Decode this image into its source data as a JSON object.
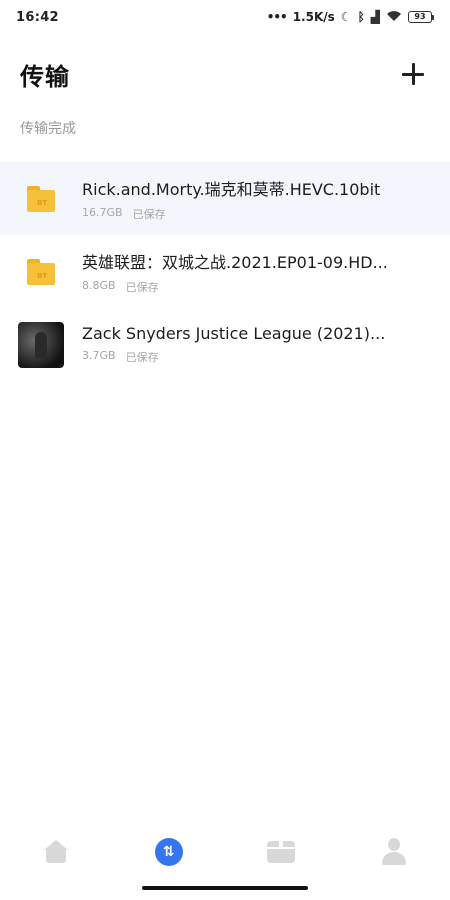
{
  "status_bar": {
    "time": "16:42",
    "network_speed": "1.5K/s",
    "battery_level": "93",
    "icons": [
      "moon-icon",
      "bluetooth-icon",
      "signal-icon",
      "wifi-icon",
      "battery-icon"
    ]
  },
  "header": {
    "title": "传输",
    "add_icon": "plus-icon"
  },
  "section": {
    "label": "传输完成"
  },
  "transfers": [
    {
      "name": "Rick.and.Morty.瑞克和莫蒂.HEVC.10bit",
      "size": "16.7GB",
      "status": "已保存",
      "icon": "folder-icon",
      "selected": true
    },
    {
      "name": "英雄联盟：双城之战.2021.EP01-09.HD...",
      "size": "8.8GB",
      "status": "已保存",
      "icon": "folder-icon",
      "selected": false
    },
    {
      "name": "Zack Snyders Justice League (2021)...",
      "size": "3.7GB",
      "status": "已保存",
      "icon": "video-thumbnail",
      "selected": false
    }
  ],
  "bottom_nav": {
    "items": [
      "home-icon",
      "transfer-icon",
      "box-icon",
      "user-icon"
    ],
    "active": "transfer-icon",
    "active_color": "#3576f0"
  },
  "colors": {
    "folder": "#f7c03a",
    "selected_row": "#f3f6fd",
    "accent": "#3576f0"
  }
}
